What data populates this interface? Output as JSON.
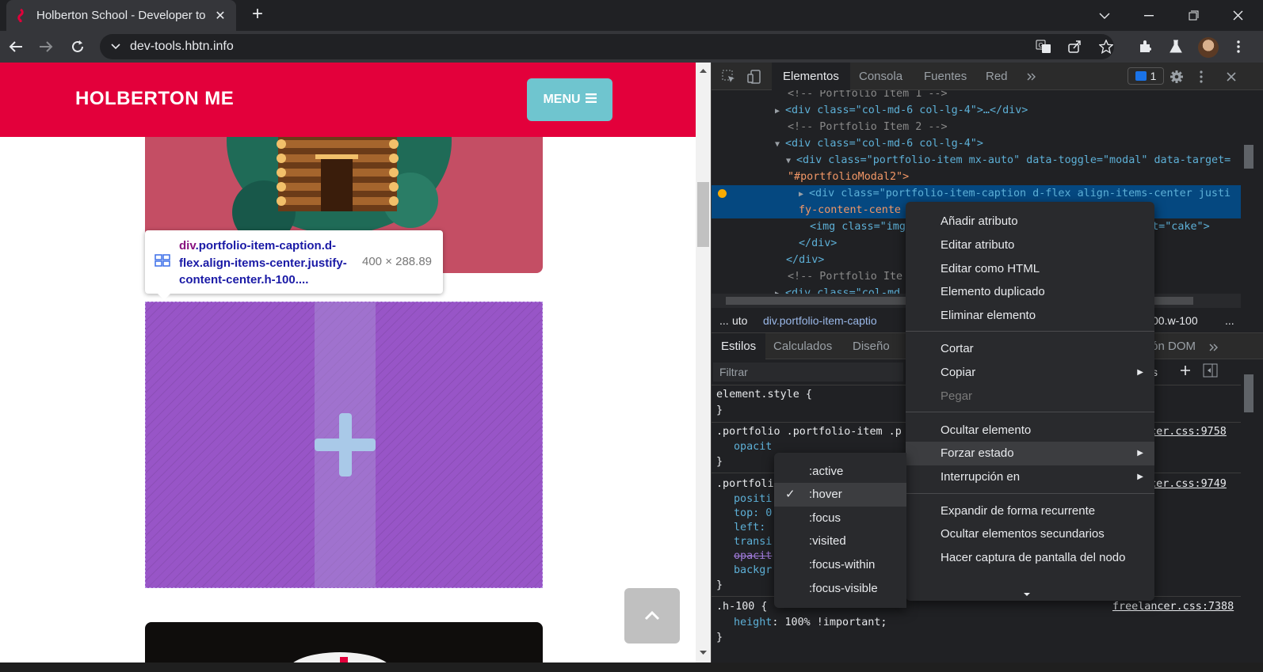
{
  "browser": {
    "tab_title": "Holberton School - Developer to",
    "tab_close": "✕",
    "new_tab": "+",
    "url": "dev-tools.hbtn.info"
  },
  "page": {
    "brand": "HOLBERTON ME",
    "menu_label": "MENU",
    "tooltip": {
      "tag": "div",
      "classes": ".portfolio-item-caption.d-flex.align-items-center.justify-content-center.h-100....",
      "dimensions": "400 × 288.89"
    }
  },
  "devtools": {
    "tabs": [
      "Elementos",
      "Consola",
      "Fuentes",
      "Red"
    ],
    "issues_count": "1",
    "dom_lines": [
      {
        "t": "<!-- Portfolio Item 1 -->"
      },
      {
        "t": "<div class=\"col-md-6 col-lg-4\">…</div>"
      },
      {
        "t": "<!-- Portfolio Item 2 -->"
      },
      {
        "t": "<div class=\"col-md-6 col-lg-4\">"
      },
      {
        "t": "<div class=\"portfolio-item mx-auto\" data-toggle=\"modal\" data-target="
      },
      {
        "t": "\"#portfolioModal2\">"
      },
      {
        "t": "<div class=\"portfolio-item-caption d-flex align-items-center justi"
      },
      {
        "t": "fy-content-cente"
      },
      {
        "t": "<img class=\"img"
      },
      {
        "t": "alt=\"cake\">"
      },
      {
        "t": "</div>"
      },
      {
        "t": "</div>"
      },
      {
        "t": "<!-- Portfolio Ite"
      },
      {
        "t": "<div class=\"col-md"
      }
    ],
    "breadcrumbs": {
      "more": "...",
      "item1": "uto",
      "item2": "div.portfolio-item-captio",
      "item3": "r.h-100.w-100",
      "overflow": "..."
    },
    "style_tabs": [
      "Estilos",
      "Calculados",
      "Diseño",
      "oción DOM"
    ],
    "filter_placeholder": "Filtrar",
    "cls_label": ".cls",
    "rules": {
      "element_style": "element.style {",
      "close": "}",
      "r1_selector": ".portfolio .portfolio-item .p",
      "r1_prop": "opacit",
      "r1_source": "ancer.css:9758",
      "r2_selector": ".portfoli",
      "r2_source": "ancer.css:9749",
      "r2_props": [
        "positi",
        "top: 0",
        "left:",
        "transi",
        "opacit",
        "backgr"
      ],
      "r3_selector": ".h-100 {",
      "r3_prop": "height",
      "r3_value": "100% !important;",
      "r3_source": "freelancer.css:7388"
    }
  },
  "context_menu": {
    "items": [
      "Añadir atributo",
      "Editar atributo",
      "Editar como HTML",
      "Elemento duplicado",
      "Eliminar elemento",
      "Cortar",
      "Copiar",
      "Pegar",
      "Ocultar elemento",
      "Forzar estado",
      "Interrupción en",
      "Expandir de forma recurrente",
      "Ocultar elementos secundarios",
      "Hacer captura de pantalla del nodo"
    ]
  },
  "force_state_menu": {
    "items": [
      ":active",
      ":hover",
      ":focus",
      ":visited",
      ":focus-within",
      ":focus-visible"
    ],
    "checked": ":hover"
  },
  "colors": {
    "brand_red": "#e3003b",
    "menu_teal": "#6fc5cf",
    "overlay_purple": "#924cc4",
    "devtools_bg": "#202124",
    "selected_row": "#054880"
  }
}
